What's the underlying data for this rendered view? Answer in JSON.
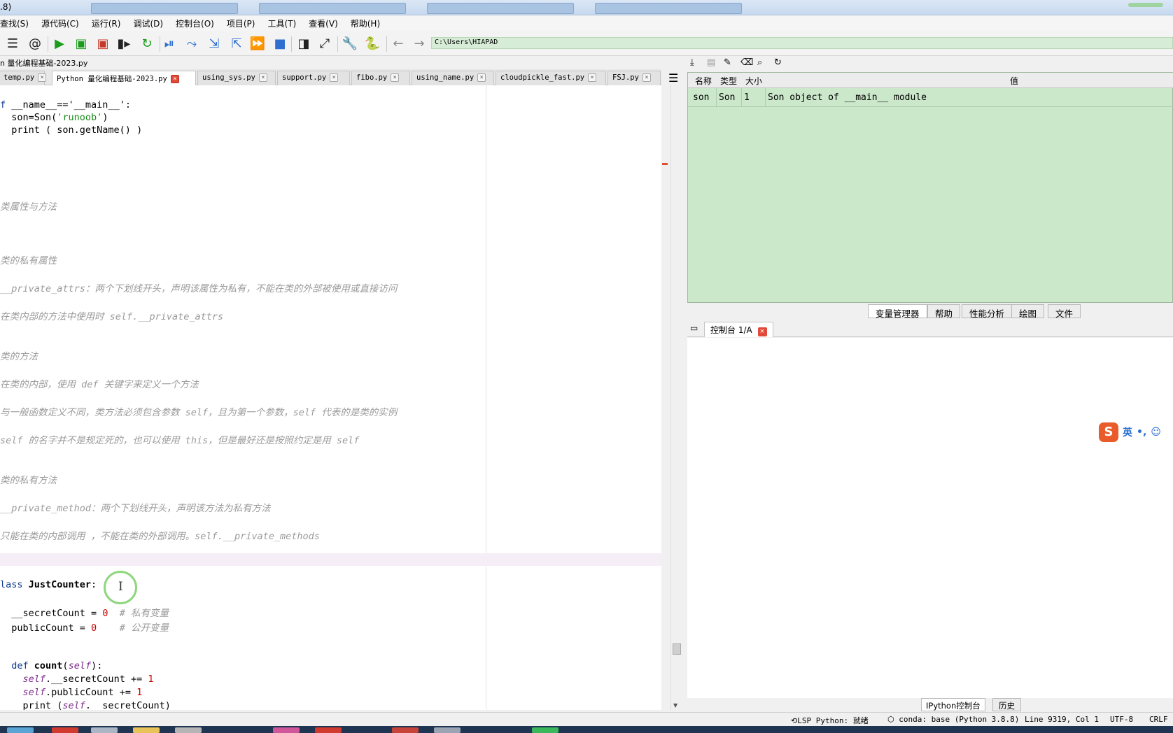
{
  "window": {
    "title_fragment": ".8)"
  },
  "menu": [
    "查找(S)",
    "源代码(C)",
    "运行(R)",
    "调试(D)",
    "控制台(O)",
    "项目(P)",
    "工具(T)",
    "查看(V)",
    "帮助(H)"
  ],
  "toolbar": {
    "icons": [
      "list-icon",
      "at-icon",
      "run-icon",
      "run-cell-icon",
      "run-cell-advance-icon",
      "run-selection-icon",
      "rerun-icon",
      "debug-icon",
      "step-icon",
      "step-into-icon",
      "step-return-icon",
      "continue-icon",
      "stop-icon",
      "maximize-pane-icon",
      "fullscreen-icon",
      "wrench-icon",
      "python-icon",
      "back-arrow-icon",
      "forward-arrow-icon"
    ],
    "path": "C:\\Users\\HIAPAD"
  },
  "editor": {
    "filepath": "n 量化编程基础-2023.py",
    "tabs": [
      {
        "label": "temp.py",
        "active": false
      },
      {
        "label": "Python 量化编程基础-2023.py",
        "active": true
      },
      {
        "label": "using_sys.py",
        "active": false
      },
      {
        "label": "support.py",
        "active": false
      },
      {
        "label": "fibo.py",
        "active": false
      },
      {
        "label": "using_name.py",
        "active": false
      },
      {
        "label": "cloudpickle_fast.py",
        "active": false
      },
      {
        "label": "FSJ.py",
        "active": false
      }
    ],
    "lines": {
      "l1a": "f ",
      "l1b": "__name__=='__main__':",
      "l2a": "  son=Son(",
      "l2b": "'runoob'",
      "l2c": ")",
      "l3": "  print ( son.getName() )",
      "c1": "类属性与方法",
      "c2": "类的私有属性",
      "c3": "__private_attrs：两个下划线开头，声明该属性为私有，不能在类的外部被使用或直接访问",
      "c4": "在类内部的方法中使用时 self.__private_attrs",
      "c5": "类的方法",
      "c6": "在类的内部，使用 def 关键字来定义一个方法",
      "c7": "与一般函数定义不同，类方法必须包含参数 self，且为第一个参数，self 代表的是类的实例",
      "c8": "self 的名字并不是规定死的，也可以使用 this，但是最好还是按照约定是用 self",
      "c9": "类的私有方法",
      "c10": "__private_method：两个下划线开头，声明该方法为私有方法",
      "c11": "只能在类的内部调用 ，不能在类的外部调用。self.__private_methods",
      "k1a": "lass ",
      "k1b": "JustCounter",
      "k1c": ":",
      "s1a": "  __secretCount = ",
      "s1b": "0",
      "s1c": "  # 私有变量",
      "s2a": "  publicCount = ",
      "s2b": "0",
      "s2c": "    # 公开变量",
      "d1a": "  def ",
      "d1b": "count",
      "d1c": "(",
      "d1d": "self",
      "d1e": "):",
      "d2a": "    ",
      "d2b": "self",
      "d2c": ".__secretCount += ",
      "d2d": "1",
      "d3a": "    ",
      "d3b": "self",
      "d3c": ".publicCount += ",
      "d3d": "1",
      "d4a": "    print (",
      "d4b": "self",
      "d4c": ".__secretCount)"
    }
  },
  "variable_explorer": {
    "headers": {
      "name": "名称",
      "type": "类型",
      "size": "大小",
      "value": "值"
    },
    "rows": [
      {
        "name": "son",
        "type": "Son",
        "size": "1",
        "value": "Son object of __main__ module"
      }
    ],
    "tools": [
      "import-data-icon",
      "save-data-icon",
      "save-as-icon",
      "eraser-icon",
      "search-icon",
      "refresh-icon"
    ],
    "pane_tabs": [
      "变量管理器",
      "帮助",
      "性能分析",
      "绘图",
      "文件"
    ]
  },
  "console": {
    "tab_label": "控制台 1/A",
    "bottom_tabs": [
      "IPython控制台",
      "历史"
    ]
  },
  "ime": {
    "label": "英",
    "marks": "•,"
  },
  "statusbar": {
    "lsp": "LSP Python: 就绪",
    "conda": "conda: base (Python 3.8.8)",
    "position": "Line 9319, Col 1",
    "encoding": "UTF-8",
    "eol": "CRLF"
  },
  "colors": {
    "accent_green": "#cbe8cb",
    "active_tab_close": "#e04a3a"
  }
}
